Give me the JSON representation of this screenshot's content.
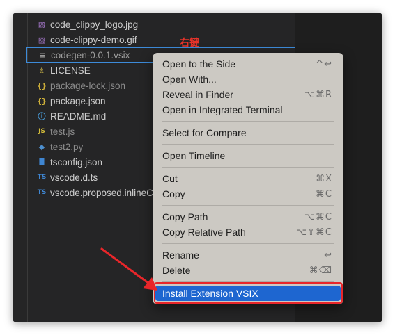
{
  "files": [
    {
      "name": "code_clippy_logo.jpg",
      "icon": "image-icon",
      "glyph": "▨",
      "cls": "ic-img",
      "dim": false
    },
    {
      "name": "code-clippy-demo.gif",
      "icon": "image-icon",
      "glyph": "▨",
      "cls": "ic-img",
      "dim": false
    },
    {
      "name": "codegen-0.0.1.vsix",
      "icon": "file-lines-icon",
      "glyph": "≡",
      "cls": "ic-lines",
      "dim": false,
      "focused": true
    },
    {
      "name": "LICENSE",
      "icon": "license-icon",
      "glyph": "♗",
      "cls": "ic-license",
      "dim": false
    },
    {
      "name": "package-lock.json",
      "icon": "json-icon",
      "glyph": "{}",
      "cls": "ic-json",
      "dim": true
    },
    {
      "name": "package.json",
      "icon": "json-icon",
      "glyph": "{}",
      "cls": "ic-json",
      "dim": false
    },
    {
      "name": "README.md",
      "icon": "info-icon",
      "glyph": "ⓘ",
      "cls": "ic-info",
      "dim": false
    },
    {
      "name": "test.js",
      "icon": "javascript-icon",
      "glyph": "JS",
      "cls": "ic-js",
      "dim": true
    },
    {
      "name": "test2.py",
      "icon": "python-icon",
      "glyph": "◆",
      "cls": "ic-py",
      "dim": true
    },
    {
      "name": "tsconfig.json",
      "icon": "tsconfig-icon",
      "glyph": "▇",
      "cls": "ic-tsconfig",
      "dim": false
    },
    {
      "name": "vscode.d.ts",
      "icon": "typescript-icon",
      "glyph": "TS",
      "cls": "ic-ts",
      "dim": false
    },
    {
      "name": "vscode.proposed.inlineCompletions.d.ts",
      "icon": "typescript-icon",
      "glyph": "TS",
      "cls": "ic-ts",
      "dim": false
    }
  ],
  "annotation": "右键",
  "context_menu": {
    "groups": [
      [
        {
          "label": "Open to the Side",
          "shortcut": "^↩"
        },
        {
          "label": "Open With...",
          "shortcut": ""
        },
        {
          "label": "Reveal in Finder",
          "shortcut": "⌥⌘R"
        },
        {
          "label": "Open in Integrated Terminal",
          "shortcut": ""
        }
      ],
      [
        {
          "label": "Select for Compare",
          "shortcut": ""
        }
      ],
      [
        {
          "label": "Open Timeline",
          "shortcut": ""
        }
      ],
      [
        {
          "label": "Cut",
          "shortcut": "⌘X"
        },
        {
          "label": "Copy",
          "shortcut": "⌘C"
        }
      ],
      [
        {
          "label": "Copy Path",
          "shortcut": "⌥⌘C"
        },
        {
          "label": "Copy Relative Path",
          "shortcut": "⌥⇧⌘C"
        }
      ],
      [
        {
          "label": "Rename",
          "shortcut": "↩"
        },
        {
          "label": "Delete",
          "shortcut": "⌘⌫"
        }
      ],
      [
        {
          "label": "Install Extension VSIX",
          "shortcut": "",
          "highlighted": true
        }
      ]
    ]
  },
  "colors": {
    "menu_highlight": "#1e66d0",
    "annotation_red": "#e8332a",
    "focus_border": "#3d8bd9"
  }
}
